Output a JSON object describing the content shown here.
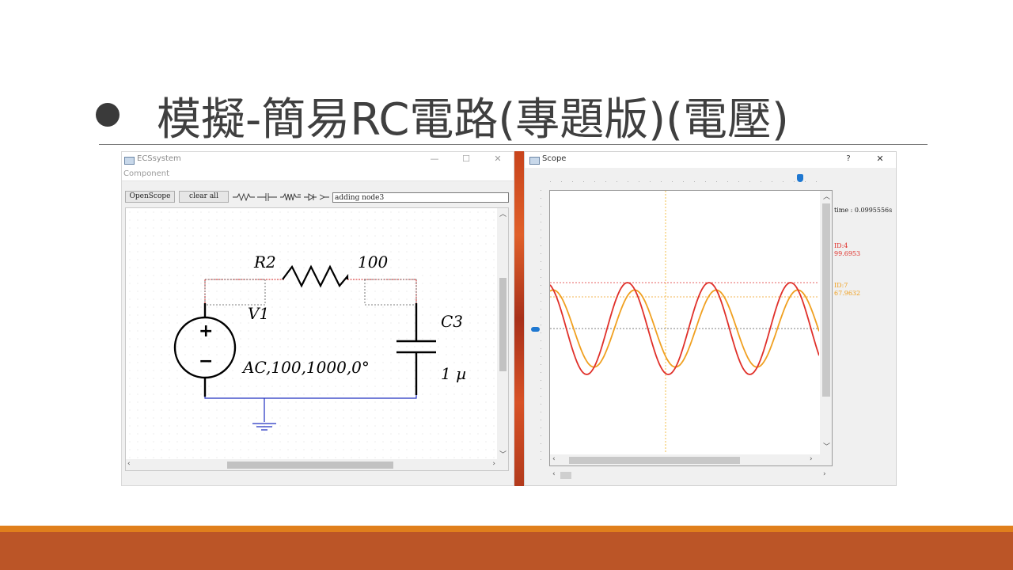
{
  "slide": {
    "title": "模擬-簡易RC電路(專題版)(電壓)",
    "colors": {
      "accent_band": "#e07f1c",
      "footer_band": "#bb5527",
      "title_text": "#3f3f3f"
    }
  },
  "ecs_window": {
    "title": "ECSsystem",
    "icon": "app-window-icon",
    "controls": {
      "minimize": "—",
      "maximize": "☐",
      "close": "✕"
    },
    "menu": [
      "Component"
    ],
    "toolbar": {
      "open_scope": "OpenScope",
      "clear_all": "clear all",
      "component_icons": [
        "resistor-icon",
        "capacitor-icon",
        "inductor-icon",
        "diode-icon",
        "wire-icon"
      ],
      "status_value": "adding node3"
    },
    "circuit": {
      "resistor_name": "R2",
      "resistor_value": "100",
      "source_name": "V1",
      "source_params": "AC,100,1000,0°",
      "capacitor_name": "C3",
      "capacitor_value": "1 µ",
      "source_plus": "+",
      "source_minus": "−"
    }
  },
  "scope_window": {
    "title": "Scope",
    "help": "?",
    "close": "✕",
    "time_readout": "time : 0.0995556s",
    "probes": [
      {
        "id": "ID:4",
        "value": "99.6953",
        "color": "#e0302a"
      },
      {
        "id": "ID:7",
        "value": "67.9632",
        "color": "#f0a020"
      }
    ],
    "time_slider_value": 0.93,
    "voltage_slider_value": 0.5
  },
  "chart_data": {
    "type": "line",
    "series": [
      {
        "name": "ID:4",
        "color": "#e0302a",
        "amplitude": 100,
        "phase_deg": 0
      },
      {
        "name": "ID:7",
        "color": "#f0a020",
        "amplitude": 84,
        "phase_deg": -32
      }
    ],
    "cycles_shown": 3.3,
    "grid": "cursor lines only"
  }
}
